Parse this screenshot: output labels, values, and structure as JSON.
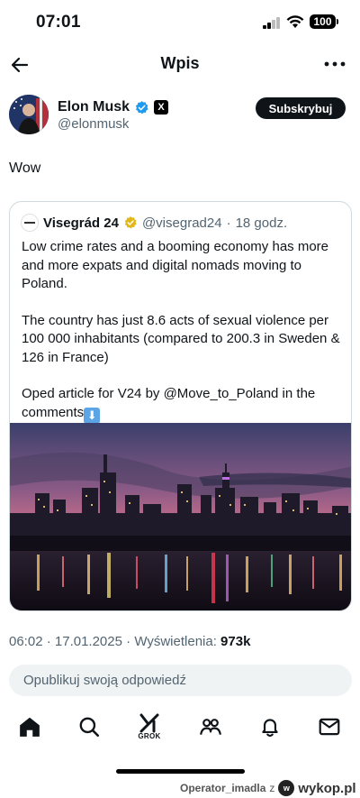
{
  "status_bar": {
    "time": "07:01",
    "battery": "100"
  },
  "header": {
    "title": "Wpis",
    "back_icon": "arrow-left-icon",
    "more_icon": "more-horizontal-icon"
  },
  "post": {
    "author": {
      "name": "Elon Musk",
      "handle": "@elonmusk",
      "verified_icon": "verified-blue-badge-icon",
      "affiliate_badge": "X"
    },
    "subscribe_label": "Subskrybuj",
    "text": "Wow",
    "quoted": {
      "name": "Visegrád 24",
      "handle": "@visegrad24",
      "separator": "·",
      "time": "18 godz.",
      "paragraphs": [
        "Low crime rates and a booming economy has more and more expats and digital nomads moving to Poland.",
        "The country has just 8.6 acts of sexual violence per 100 000 inhabitants (compared to 200.3 in Sweden & 126 in France)",
        "Oped article for V24 by @Move_to_Poland in the comments"
      ],
      "emoji": "⬇",
      "image_description_icon": "city-skyline-image"
    },
    "meta": {
      "time": "06:02",
      "date": "17.01.2025",
      "views_label": "Wyświetlenia:",
      "views": "973k",
      "separator": "·"
    },
    "reply_placeholder": "Opublikuj swoją odpowiedź"
  },
  "tab_bar": {
    "items": [
      {
        "icon": "home-icon"
      },
      {
        "icon": "search-icon"
      },
      {
        "icon": "grok-icon",
        "label": "GROK"
      },
      {
        "icon": "communities-icon"
      },
      {
        "icon": "notifications-icon"
      },
      {
        "icon": "messages-icon"
      }
    ]
  },
  "watermark": {
    "user": "Operator_imadla",
    "connector": "z",
    "site": "wykop.pl"
  },
  "colors": {
    "text": "#0f1419",
    "secondary": "#536471",
    "verified_blue": "#1d9bf0",
    "gold": "#e2b719",
    "border": "#cfd9de",
    "input_bg": "#eff3f4"
  }
}
